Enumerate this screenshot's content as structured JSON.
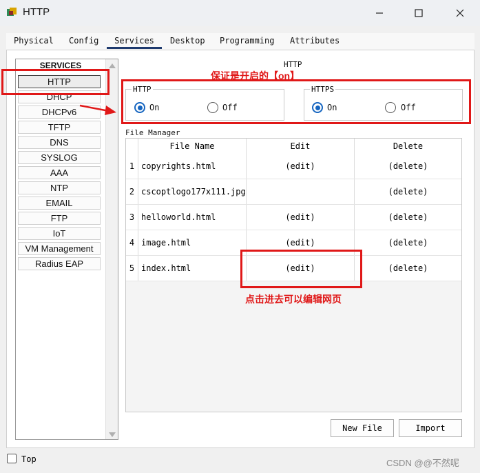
{
  "window": {
    "title": "HTTP"
  },
  "tabs": [
    "Physical",
    "Config",
    "Services",
    "Desktop",
    "Programming",
    "Attributes"
  ],
  "services": {
    "header": "SERVICES",
    "items": [
      "HTTP",
      "DHCP",
      "DHCPv6",
      "TFTP",
      "DNS",
      "SYSLOG",
      "AAA",
      "NTP",
      "EMAIL",
      "FTP",
      "IoT",
      "VM Management",
      "Radius EAP"
    ],
    "selected": "HTTP"
  },
  "http_page": {
    "title": "HTTP",
    "http_group": {
      "label": "HTTP",
      "on_label": "On",
      "off_label": "Off",
      "value": "On"
    },
    "https_group": {
      "label": "HTTPS",
      "on_label": "On",
      "off_label": "Off",
      "value": "On"
    },
    "file_manager": {
      "label": "File Manager",
      "columns": [
        "File Name",
        "Edit",
        "Delete"
      ],
      "rows": [
        {
          "num": "1",
          "name": "copyrights.html",
          "edit": "(edit)",
          "delete": "(delete)"
        },
        {
          "num": "2",
          "name": "cscoptlogo177x111.jpg",
          "edit": "",
          "delete": "(delete)"
        },
        {
          "num": "3",
          "name": "helloworld.html",
          "edit": "(edit)",
          "delete": "(delete)"
        },
        {
          "num": "4",
          "name": "image.html",
          "edit": "(edit)",
          "delete": "(delete)"
        },
        {
          "num": "5",
          "name": "index.html",
          "edit": "(edit)",
          "delete": "(delete)"
        }
      ]
    },
    "buttons": {
      "new_file": "New File",
      "import": "Import"
    }
  },
  "annotations": {
    "ensure_on": "保证是开启的【on】",
    "click_edit": "点击进去可以编辑网页"
  },
  "bottom": {
    "top_label": "Top",
    "watermark": "CSDN @@不然呢"
  },
  "colors": {
    "annotation_red": "#e01818",
    "radio_blue": "#1565c0",
    "tab_underline": "#1e3a6e"
  }
}
